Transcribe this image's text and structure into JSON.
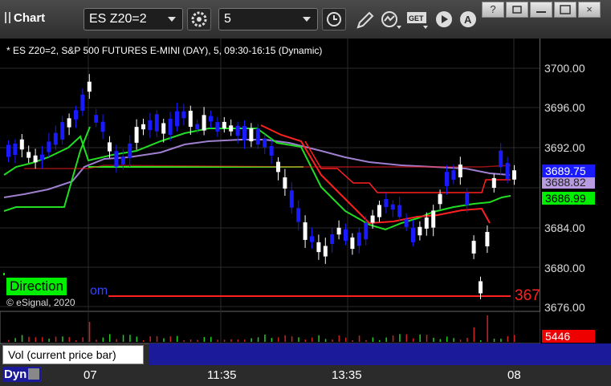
{
  "toolbar": {
    "title": "Chart",
    "symbol": "ES Z20=2",
    "interval": "5"
  },
  "window_buttons": {
    "help": "?",
    "restore": "",
    "maximize": "",
    "close": "×"
  },
  "chart": {
    "header": "* ES Z20=2, S&P 500 FUTURES E-MINI (DAY), 5, 09:30-16:15 (Dynamic)",
    "direction_label": "Direction",
    "direction_partial": "om",
    "copyright": "© eSignal, 2020",
    "y_ticks": [
      "3700.00",
      "3696.00",
      "3692.00",
      "3684.00",
      "3680.00",
      "3676.00"
    ],
    "price_tags": {
      "blue": "3689.75",
      "purple": "3688.82",
      "green": "3686.99",
      "red_partial": "367"
    },
    "time_ticks": [
      "07",
      "11:35",
      "13:35",
      "08"
    ],
    "colors": {
      "up": "#ffffff",
      "down": "#1a1aff",
      "red_line": "#ff2020",
      "green_line": "#22dd22",
      "purple_line": "#9f7fd0",
      "flat_green": "#22ee22"
    }
  },
  "volume": {
    "label": "Vol (current price bar)",
    "value": "5446",
    "close": "×"
  },
  "footer": {
    "dyn": "Dyn"
  }
}
